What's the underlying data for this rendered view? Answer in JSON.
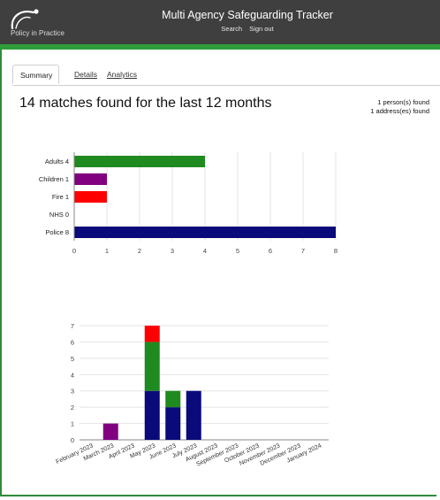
{
  "header": {
    "logo_text": "Policy in Practice",
    "app_title": "Multi Agency Safeguarding Tracker",
    "nav": [
      "Search",
      "Sign out"
    ]
  },
  "tabs": [
    {
      "label": "Summary",
      "active": true
    },
    {
      "label": "Details",
      "active": false
    },
    {
      "label": "Analytics",
      "active": false
    }
  ],
  "summary": {
    "headline": "14 matches found for the last 12 months",
    "persons_found": "1 person(s) found",
    "addresses_found": "1 address(es) found"
  },
  "colors": {
    "green": "#1f8a1f",
    "purple": "#800080",
    "red": "#ff0000",
    "navy": "#0a0a7a",
    "header_bg": "#3f3f3f",
    "accent": "#2e9e3a"
  },
  "chart_data": [
    {
      "type": "bar",
      "orientation": "horizontal",
      "categories": [
        "Adults 4",
        "Children 1",
        "Fire 1",
        "NHS 0",
        "Police 8"
      ],
      "values": [
        4,
        1,
        1,
        0,
        8
      ],
      "bar_colors": [
        "#1f8a1f",
        "#800080",
        "#ff0000",
        "#1f8a1f",
        "#0a0a7a"
      ],
      "xlim": [
        0,
        8
      ],
      "x_ticks": [
        "0",
        "1",
        "2",
        "3",
        "4",
        "5",
        "6",
        "7",
        "8"
      ],
      "grid": true
    },
    {
      "type": "bar",
      "stacked": true,
      "categories": [
        "February 2023",
        "March 2023",
        "April 2023",
        "May 2023",
        "June 2023",
        "July 2023",
        "August 2023",
        "September 2023",
        "October 2023",
        "November 2023",
        "December 2023",
        "January 2024"
      ],
      "series": [
        {
          "color": "#0a0a7a",
          "values": [
            0,
            0,
            0,
            3,
            2,
            3,
            0,
            0,
            0,
            0,
            0,
            0
          ]
        },
        {
          "color": "#800080",
          "values": [
            0,
            1,
            0,
            0,
            0,
            0,
            0,
            0,
            0,
            0,
            0,
            0
          ]
        },
        {
          "color": "#1f8a1f",
          "values": [
            0,
            0,
            0,
            3,
            1,
            0,
            0,
            0,
            0,
            0,
            0,
            0
          ]
        },
        {
          "color": "#ff0000",
          "values": [
            0,
            0,
            0,
            1,
            0,
            0,
            0,
            0,
            0,
            0,
            0,
            0
          ]
        }
      ],
      "ylim": [
        0,
        7
      ],
      "y_ticks": [
        "0",
        "1",
        "2",
        "3",
        "4",
        "5",
        "6",
        "7"
      ],
      "grid": true
    }
  ]
}
